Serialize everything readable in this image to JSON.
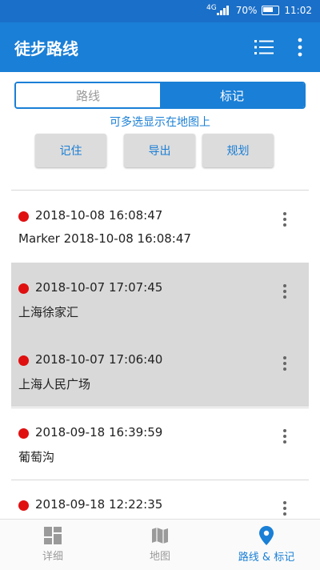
{
  "status_bar": {
    "network": "4G",
    "battery": "70%",
    "time": "11:02"
  },
  "app_bar": {
    "title": "徒步路线"
  },
  "segment": {
    "tab_routes": "路线",
    "tab_markers": "标记"
  },
  "hint": "可多选显示在地图上",
  "actions": {
    "remember": "记住",
    "export": "导出",
    "plan": "规划"
  },
  "markers": [
    {
      "time": "2018-10-08 16:08:47",
      "name": "Marker 2018-10-08 16:08:47",
      "selected": false
    },
    {
      "time": "2018-10-07 17:07:45",
      "name": "上海徐家汇",
      "selected": true
    },
    {
      "time": "2018-10-07 17:06:40",
      "name": "上海人民广场",
      "selected": true
    },
    {
      "time": "2018-09-18 16:39:59",
      "name": "葡萄沟",
      "selected": false
    },
    {
      "time": "2018-09-18 12:22:35",
      "name": "",
      "selected": false
    }
  ],
  "bottom_nav": {
    "details": "详细",
    "map": "地图",
    "routes_markers": "路线 & 标记"
  },
  "colors": {
    "primary": "#1a7fd6",
    "status": "#1a6fc8",
    "marker_dot": "#e01010",
    "selected_row": "#d9d9d9"
  }
}
